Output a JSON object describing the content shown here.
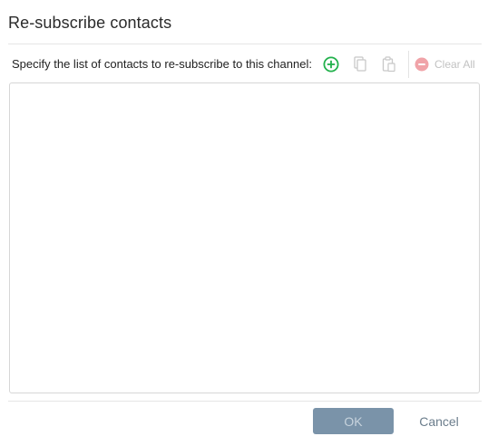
{
  "dialog": {
    "title": "Re-subscribe contacts",
    "instruction": "Specify the list of contacts to re-subscribe to this channel:",
    "toolbar": {
      "add_icon": "add-circle-icon",
      "copy_icon": "copy-icon",
      "paste_icon": "paste-icon",
      "clear_icon": "remove-circle-icon",
      "clear_all_label": "Clear All"
    },
    "contacts_list": [],
    "buttons": {
      "ok_label": "OK",
      "cancel_label": "Cancel"
    },
    "colors": {
      "add_icon": "#22b14c",
      "disabled": "#c2c2c2",
      "ok_button": "#7a93a9",
      "cancel_text": "#6b7d8c"
    }
  }
}
